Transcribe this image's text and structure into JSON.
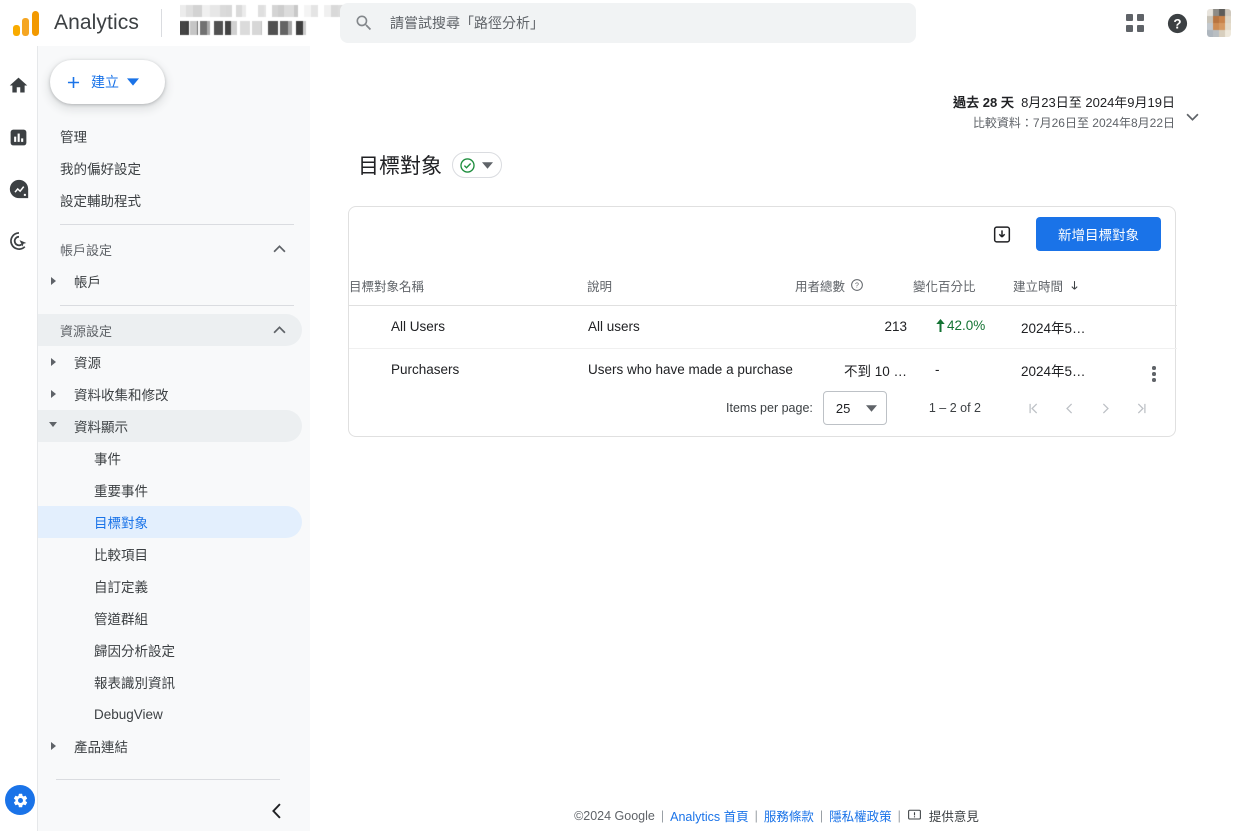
{
  "topbar": {
    "brand": "Analytics",
    "property_selector_label": "",
    "search_placeholder": "請嘗試搜尋「路徑分析」",
    "search_value": "",
    "apps_icon": "apps-grid-icon",
    "help_icon": "help-icon",
    "avatar_icon": "user-avatar"
  },
  "rail": {
    "items": [
      {
        "name": "home",
        "icon": "home-icon"
      },
      {
        "name": "reports",
        "icon": "bar-chart-icon"
      },
      {
        "name": "explore",
        "icon": "explore-trend-icon"
      },
      {
        "name": "advertising",
        "icon": "target-cursor-icon"
      }
    ],
    "admin": {
      "name": "admin",
      "icon": "gear-icon",
      "active_color": "#1a73e8"
    }
  },
  "sidebar": {
    "create_button": "建立",
    "items": [
      {
        "label": "管理",
        "level": 1,
        "expander": false,
        "selected": false
      },
      {
        "label": "我的偏好設定",
        "level": 1,
        "expander": false,
        "selected": false
      },
      {
        "label": "設定輔助程式",
        "level": 1,
        "expander": false,
        "selected": false
      }
    ],
    "sections": [
      {
        "title": "帳戶設定",
        "collapsed": false,
        "items": [
          {
            "label": "帳戶",
            "expander": "right",
            "selected": false
          }
        ]
      },
      {
        "title": "資源設定",
        "collapsed": false,
        "items": [
          {
            "label": "資源",
            "expander": "right",
            "selected": false
          },
          {
            "label": "資料收集和修改",
            "expander": "right",
            "selected": false
          },
          {
            "label": "資料顯示",
            "expander": "down",
            "selected": false,
            "group": true
          },
          {
            "label": "事件",
            "expander": false,
            "selected": false,
            "indent": true
          },
          {
            "label": "重要事件",
            "expander": false,
            "selected": false,
            "indent": true
          },
          {
            "label": "目標對象",
            "expander": false,
            "selected": true,
            "indent": true
          },
          {
            "label": "比較項目",
            "expander": false,
            "selected": false,
            "indent": true
          },
          {
            "label": "自訂定義",
            "expander": false,
            "selected": false,
            "indent": true
          },
          {
            "label": "管道群組",
            "expander": false,
            "selected": false,
            "indent": true
          },
          {
            "label": "歸因分析設定",
            "expander": false,
            "selected": false,
            "indent": true
          },
          {
            "label": "報表識別資訊",
            "expander": false,
            "selected": false,
            "indent": true
          },
          {
            "label": "DebugView",
            "expander": false,
            "selected": false,
            "indent": true
          },
          {
            "label": "產品連結",
            "expander": "right",
            "selected": false
          }
        ]
      }
    ],
    "collapse_icon": "chevron-left-icon"
  },
  "daterange": {
    "line1_prefix": "過去 28 天",
    "line1_range": "8月23日至 2024年9月19日",
    "line2": "比較資料：7月26日至 2024年8月22日",
    "caret_icon": "chevron-down-icon"
  },
  "page": {
    "title": "目標對象",
    "status_icon": "check-circle-icon",
    "status_color": "#1e8e3e",
    "status_caret_icon": "chevron-down-icon"
  },
  "card": {
    "download_icon": "download-icon",
    "primary_button": "新增目標對象",
    "primary_color": "#1a73e8",
    "columns": [
      {
        "label": "目標對象名稱",
        "key": "name"
      },
      {
        "label": "說明",
        "key": "description"
      },
      {
        "label": "用者總數",
        "key": "users",
        "help_icon": "help-circle-icon"
      },
      {
        "label": "變化百分比",
        "key": "change"
      },
      {
        "label": "建立時間",
        "key": "created",
        "sort_icon": "arrow-down-icon"
      }
    ],
    "rows": [
      {
        "name": "All Users",
        "description": "All users",
        "users": "213",
        "change": "42.0%",
        "change_direction": "up",
        "change_color": "#137333",
        "created": "2024年5…",
        "menu_icon": "more-vert-icon"
      },
      {
        "name": "Purchasers",
        "description": "Users who have made a purchase",
        "users": "不到 10 …",
        "change": "-",
        "change_direction": "none",
        "change_color": "#5f6368",
        "created": "2024年5…",
        "menu_icon": "more-vert-icon"
      }
    ],
    "pagination": {
      "items_per_page_label": "Items per page:",
      "items_per_page_value": "25",
      "range_label": "1 – 2 of 2",
      "first_icon": "first-page-icon",
      "prev_icon": "prev-page-icon",
      "next_icon": "next-page-icon",
      "last_icon": "last-page-icon"
    }
  },
  "footer": {
    "copyright": "©2024 Google",
    "links": [
      "Analytics 首頁",
      "服務條款",
      "隱私權政策"
    ],
    "separator": "|",
    "feedback_label": "提供意見",
    "feedback_icon": "feedback-icon"
  }
}
